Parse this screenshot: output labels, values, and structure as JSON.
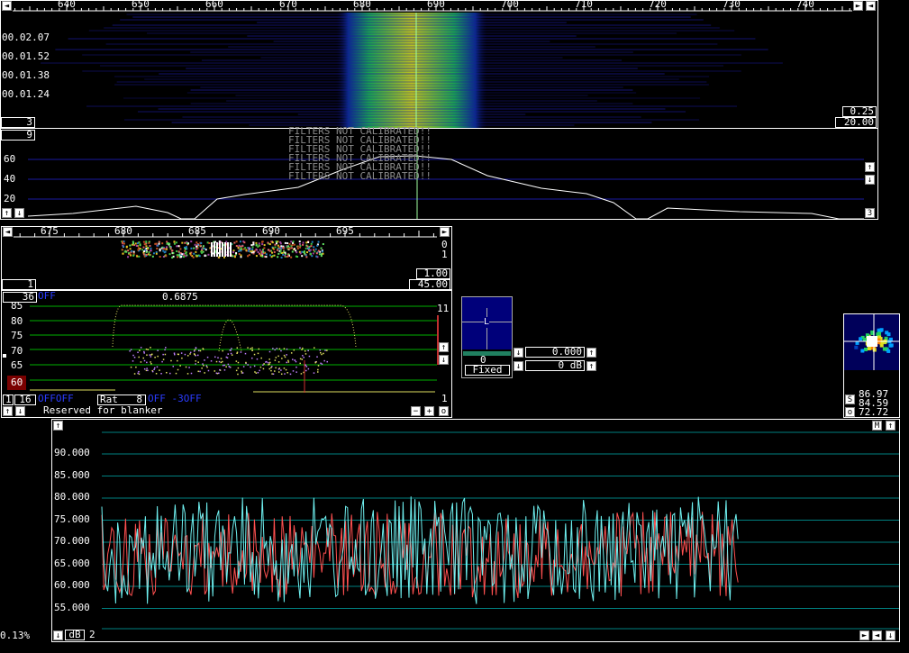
{
  "waterfall": {
    "freq_ticks": [
      "640",
      "650",
      "660",
      "670",
      "680",
      "690",
      "700",
      "710",
      "720",
      "730",
      "740"
    ],
    "times": [
      "00.02.07",
      "00.01.52",
      "00.01.38",
      "00.01.24"
    ],
    "left_box": "3",
    "right_box_top": "0.25",
    "right_box_bottom": "20.00"
  },
  "spectrum": {
    "left_box": "9",
    "y_ticks": [
      "60",
      "40",
      "20"
    ],
    "filters_msg": "FILTERS NOT CALIBRATED!!",
    "right_box": "3"
  },
  "hires": {
    "freq_ticks": [
      "675",
      "680",
      "685",
      "690",
      "695"
    ],
    "right_vals": [
      "0",
      "1"
    ],
    "left_box": "1",
    "box_top": "1.00",
    "box_bottom": "45.00"
  },
  "baseband": {
    "box_36": "36",
    "off_label": "OFF",
    "center_val": "0.6875",
    "y_ticks": [
      "85",
      "80",
      "75",
      "70",
      "65",
      "60"
    ],
    "right_val_top": "11",
    "right_val_bottom": "1",
    "bottom_box1": "1",
    "bottom_box2": "16",
    "bottom_offoff": "OFFOFF",
    "rat_label": "Rat",
    "rat_val": "8",
    "bottom_blue2": "OFF -3OFF",
    "reserved_text": "Reserved for blanker",
    "minus_btn": "−",
    "plus_btn": "+",
    "o_btn": "o"
  },
  "afc": {
    "value": "0",
    "mode": "Fixed",
    "field1": "0.000",
    "field2": "0 dB",
    "marker": "L"
  },
  "meter": {
    "s_label": "S",
    "o_label": "o",
    "v1": "86.97",
    "v2": "84.59",
    "v3": "72.72"
  },
  "strength": {
    "y_ticks": [
      "90.000",
      "85.000",
      "80.000",
      "75.000",
      "70.000",
      "65.000",
      "60.000",
      "55.000"
    ],
    "m_btn": "M",
    "db_label": "dB",
    "db_val": "2",
    "percent": "0.13%"
  },
  "colors": {
    "grid_blue": "#1a1aa0",
    "grid_green": "#00b000",
    "trace_cyan": "#6ff0f0",
    "trace_red": "#ff5050",
    "grid_teal": "#008080"
  }
}
